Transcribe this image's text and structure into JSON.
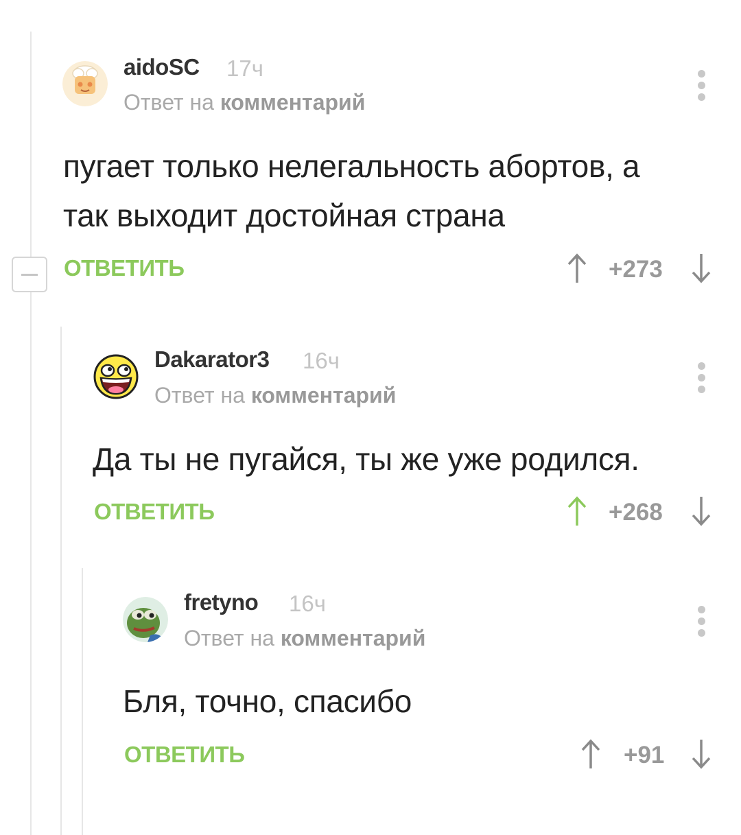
{
  "comments": [
    {
      "author": "aidoSC",
      "time": "17ч",
      "reply_prefix": "Ответ на",
      "reply_link": "комментарий",
      "text_lines": [
        "пугает только нелегальность абортов, а",
        "так выходит достойная страна"
      ],
      "reply_label": "ОТВЕТИТЬ",
      "score": "+273",
      "upvoted": false,
      "avatar": "chef-avatar"
    },
    {
      "author": "Dakarator3",
      "time": "16ч",
      "reply_prefix": "Ответ на",
      "reply_link": "комментарий",
      "text_lines": [
        "Да ты не пугайся, ты же уже родился."
      ],
      "reply_label": "ОТВЕТИТЬ",
      "score": "+268",
      "upvoted": true,
      "avatar": "awesome-face-avatar"
    },
    {
      "author": "fretyno",
      "time": "16ч",
      "reply_prefix": "Ответ на",
      "reply_link": "комментарий",
      "text_lines": [
        "Бля, точно, спасибо"
      ],
      "reply_label": "ОТВЕТИТЬ",
      "score": "+91",
      "upvoted": false,
      "avatar": "pepe-frog-avatar"
    }
  ],
  "colors": {
    "accent": "#8cc95c",
    "muted": "#999999",
    "text": "#222222",
    "thread_line": "#e6e6e6"
  }
}
